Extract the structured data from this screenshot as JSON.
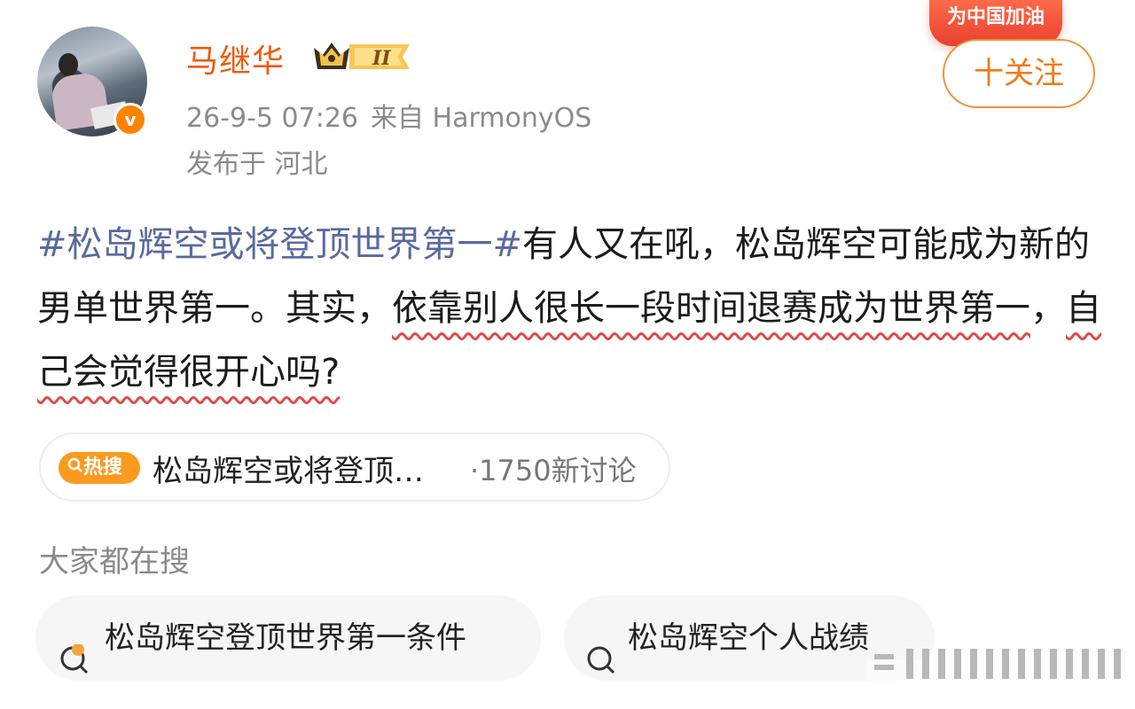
{
  "post": {
    "username": "马继华",
    "timestamp": "26-9-5 07:26",
    "source": "来自 HarmonyOS",
    "location": "发布于 河北",
    "level_badge": "II",
    "event_badge": "为中国加油",
    "follow_label": "十关注",
    "body": {
      "topic": "#松岛辉空或将登顶世界第一#",
      "text_a": "有人又在吼，松岛辉空可能成为新的男单世界第一。其实，",
      "text_underlined_1": "依靠别人很长一段时间退赛成为世界第一",
      "text_b": "，",
      "text_underlined_2": "自己会觉得很开心吗?"
    }
  },
  "hot_search": {
    "tag": "热搜",
    "title": "松岛辉空或将登顶…",
    "count": "·1750新讨论"
  },
  "related": {
    "heading": "大家都在搜",
    "chips": [
      {
        "label": "松岛辉空登顶世界第一条件",
        "icon": "hot-search-icon"
      },
      {
        "label": "松岛辉空个人战绩",
        "icon": "search-icon"
      }
    ]
  },
  "colors": {
    "username": "#f05a0c",
    "topic_link": "#5a6aa0",
    "hot_tag": "#fb9a1e",
    "follow_border": "#f0923c",
    "underline": "#e04a4a"
  }
}
